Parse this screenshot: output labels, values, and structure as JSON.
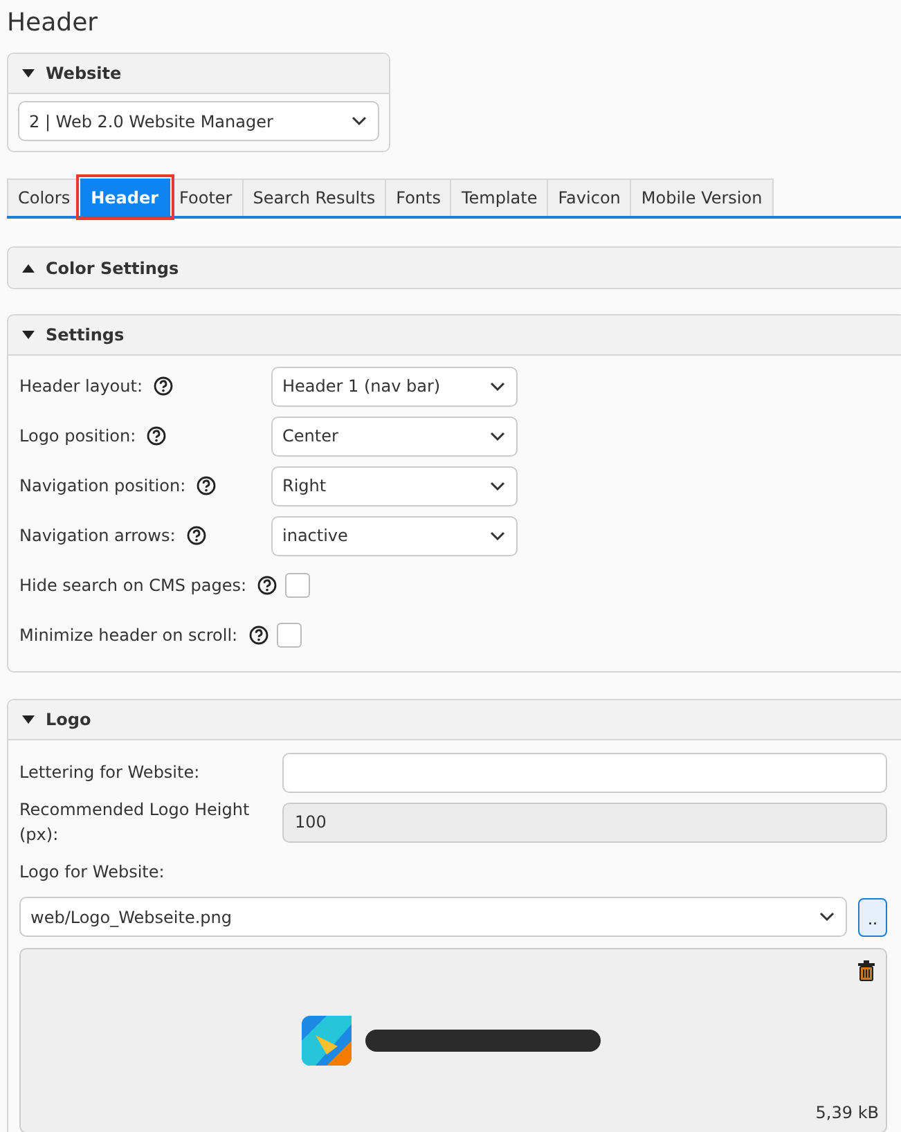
{
  "page_title": "Header",
  "website_panel": {
    "title": "Website",
    "expanded": true,
    "select_value": "2 | Web 2.0 Website Manager"
  },
  "tabs": [
    {
      "label": "Colors",
      "selected": false,
      "highlighted": false
    },
    {
      "label": "Header",
      "selected": true,
      "highlighted": true
    },
    {
      "label": "Footer",
      "selected": false,
      "highlighted": false
    },
    {
      "label": "Search Results",
      "selected": false,
      "highlighted": false
    },
    {
      "label": "Fonts",
      "selected": false,
      "highlighted": false
    },
    {
      "label": "Template",
      "selected": false,
      "highlighted": false
    },
    {
      "label": "Favicon",
      "selected": false,
      "highlighted": false
    },
    {
      "label": "Mobile Version",
      "selected": false,
      "highlighted": false
    }
  ],
  "color_settings_panel": {
    "title": "Color Settings",
    "expanded": false
  },
  "settings_panel": {
    "title": "Settings",
    "expanded": true,
    "fields": [
      {
        "kind": "select",
        "label": "Header layout:",
        "value": "Header 1 (nav bar)"
      },
      {
        "kind": "select",
        "label": "Logo position:",
        "value": "Center"
      },
      {
        "kind": "select",
        "label": "Navigation position:",
        "value": "Right"
      },
      {
        "kind": "select",
        "label": "Navigation arrows:",
        "value": "inactive"
      },
      {
        "kind": "checkbox",
        "label": "Hide search on CMS pages:",
        "checked": false
      },
      {
        "kind": "checkbox",
        "label": "Minimize header on scroll:",
        "checked": false
      }
    ]
  },
  "logo_panel": {
    "title": "Logo",
    "expanded": true,
    "lettering": {
      "label": "Lettering for Website:"
    },
    "logo_height": {
      "label": "Recommended Logo Height (px):",
      "value": "100",
      "disabled": true
    },
    "logo_file": {
      "label": "Logo for Website:",
      "value": "web/Logo_Webseite.png",
      "browse_button": ".."
    },
    "preview": {
      "kind": "picture",
      "file_size": "5,39 kB"
    }
  }
}
